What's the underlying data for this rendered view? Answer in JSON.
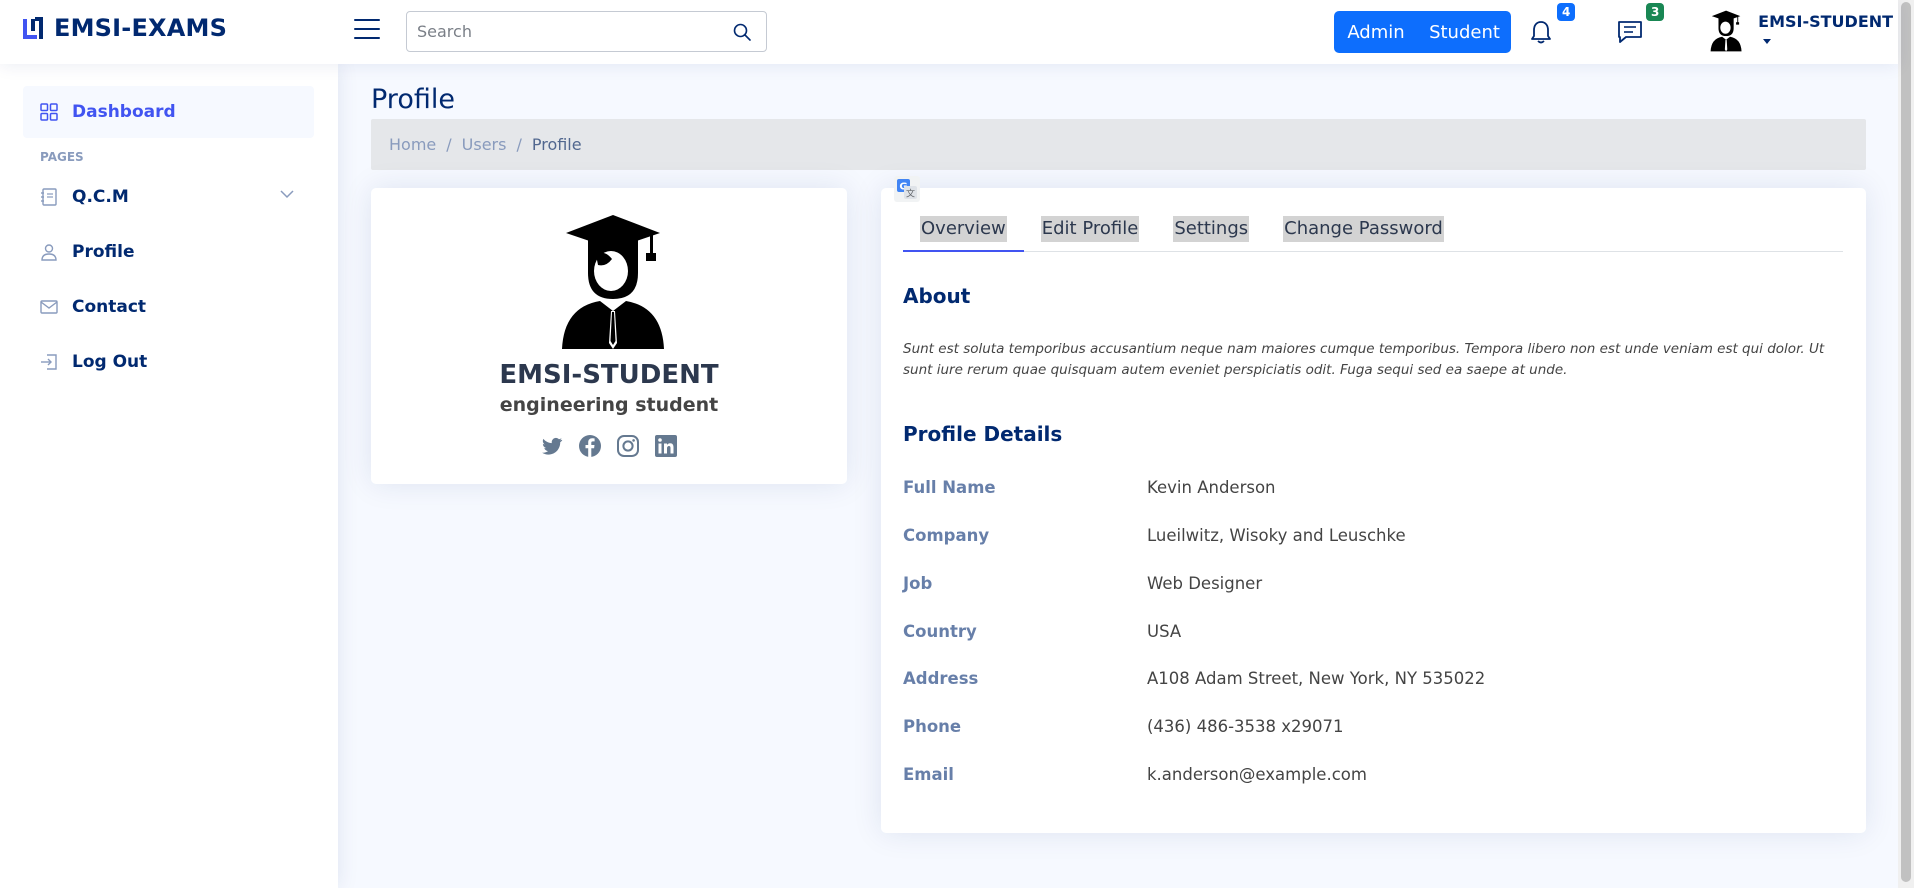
{
  "brand": {
    "name": "EMSI-EXAMS"
  },
  "header": {
    "search_placeholder": "Search",
    "roles": {
      "admin": "Admin",
      "student": "Student"
    },
    "notifications_count": "4",
    "messages_count": "3",
    "user_name": "EMSI-STUDENT"
  },
  "sidebar": {
    "dashboard": "Dashboard",
    "section_heading": "PAGES",
    "qcm": "Q.C.M",
    "profile": "Profile",
    "contact": "Contact",
    "logout": "Log Out"
  },
  "page": {
    "title": "Profile",
    "breadcrumb": [
      "Home",
      "Users",
      "Profile"
    ]
  },
  "profile_card": {
    "name": "EMSI-STUDENT",
    "role": "engineering student",
    "socials": [
      "twitter-icon",
      "facebook-icon",
      "instagram-icon",
      "linkedin-icon"
    ]
  },
  "tabs": [
    "Overview",
    "Edit Profile",
    "Settings",
    "Change Password"
  ],
  "about": {
    "title": "About",
    "text": "Sunt est soluta temporibus accusantium neque nam maiores cumque temporibus. Tempora libero non est unde veniam est qui dolor. Ut sunt iure rerum quae quisquam autem eveniet perspiciatis odit. Fuga sequi sed ea saepe at unde."
  },
  "details": {
    "title": "Profile Details",
    "rows": [
      {
        "label": "Full Name",
        "value": "Kevin Anderson"
      },
      {
        "label": "Company",
        "value": "Lueilwitz, Wisoky and Leuschke"
      },
      {
        "label": "Job",
        "value": "Web Designer"
      },
      {
        "label": "Country",
        "value": "USA"
      },
      {
        "label": "Address",
        "value": "A108 Adam Street, New York, NY 535022"
      },
      {
        "label": "Phone",
        "value": "(436) 486-3538 x29071"
      },
      {
        "label": "Email",
        "value": "k.anderson@example.com"
      }
    ]
  },
  "colors": {
    "navy": "#012970",
    "accent": "#4154f1",
    "primary": "#0d6efd",
    "success": "#198754"
  }
}
